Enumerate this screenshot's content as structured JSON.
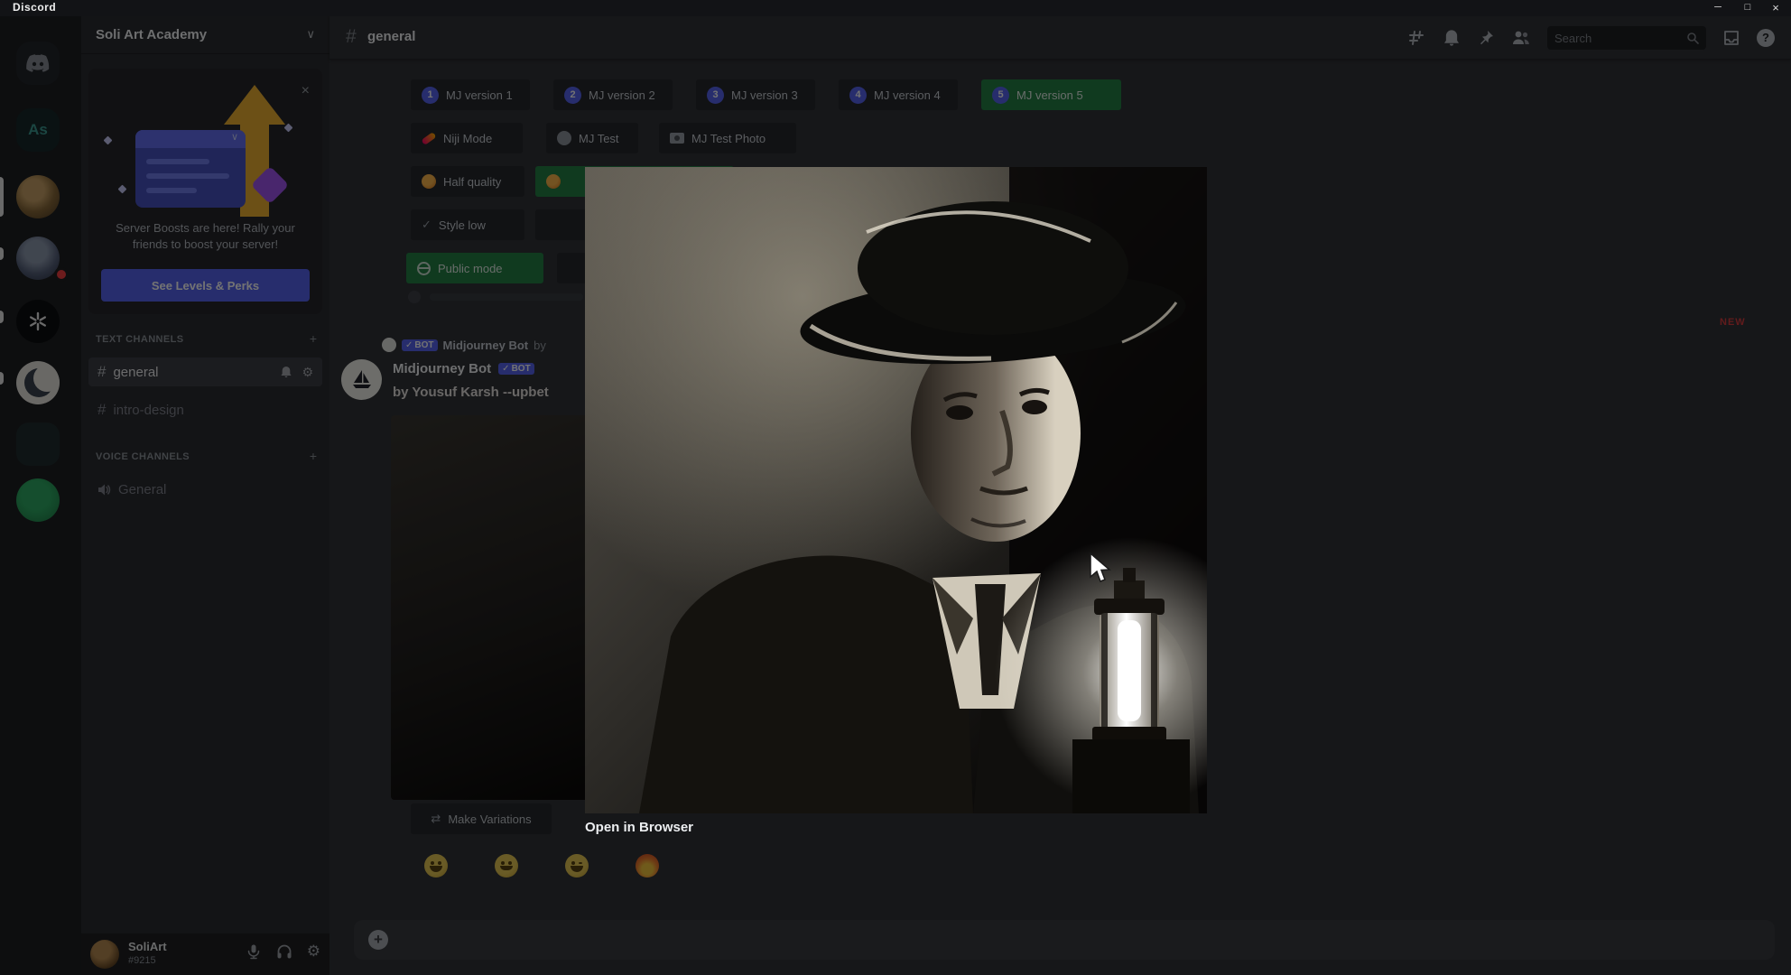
{
  "icons": {
    "chevron_down": "∨",
    "close": "×",
    "plus": "+",
    "hash": "#",
    "check": "✓",
    "gear": "⚙",
    "question": "?",
    "plus_circle": "+",
    "minimize": "─",
    "maximize": "□",
    "window_close": "×",
    "shuffle": "⇄",
    "card_chevron": "∨"
  },
  "titlebar": {
    "app_name": "Discord"
  },
  "server_rail": {
    "as_server_label": "As"
  },
  "sidebar": {
    "server_name": "Soli Art Academy",
    "boost_banner": {
      "message": "Server Boosts are here! Rally your friends to boost your server!",
      "cta_label": "See Levels & Perks"
    },
    "text_channels_header": "TEXT CHANNELS",
    "voice_channels_header": "VOICE CHANNELS",
    "channels": [
      {
        "name": "general"
      },
      {
        "name": "intro-design"
      }
    ],
    "voice_channels": [
      {
        "name": "General"
      }
    ],
    "user_panel": {
      "username": "SoliArt",
      "tag": "#9215"
    }
  },
  "chat_header": {
    "channel_name": "general",
    "search_placeholder": "Search"
  },
  "chat": {
    "version_buttons": [
      {
        "num": "1",
        "label": "MJ version 1"
      },
      {
        "num": "2",
        "label": "MJ version 2"
      },
      {
        "num": "3",
        "label": "MJ version 3"
      },
      {
        "num": "4",
        "label": "MJ version 4"
      },
      {
        "num": "5",
        "label": "MJ version 5"
      }
    ],
    "mode_buttons": [
      {
        "label": "Niji Mode"
      },
      {
        "label": "MJ Test"
      },
      {
        "label": "MJ Test Photo"
      }
    ],
    "quality_button": {
      "label": "Half quality"
    },
    "style_button": {
      "label": "Style low"
    },
    "privacy_button": {
      "label": "Public mode"
    },
    "reply": {
      "author": "Midjourney Bot",
      "bot_badge": "BOT",
      "preview": "by"
    },
    "message": {
      "author": "Midjourney Bot",
      "bot_badge": "BOT",
      "text": "by Yousuf Karsh --upbet"
    },
    "make_variations_label": "Make Variations",
    "new_badge": "NEW",
    "reactions": [
      {
        "name": "grinning-face"
      },
      {
        "name": "smiling-face"
      },
      {
        "name": "winking-face"
      },
      {
        "name": "fire"
      }
    ]
  },
  "lightbox": {
    "open_in_browser_label": "Open in Browser"
  },
  "colors": {
    "blurple": "#5865f2",
    "green": "#248046",
    "red_badge": "#d83c3e",
    "gold": "#f0b232"
  }
}
